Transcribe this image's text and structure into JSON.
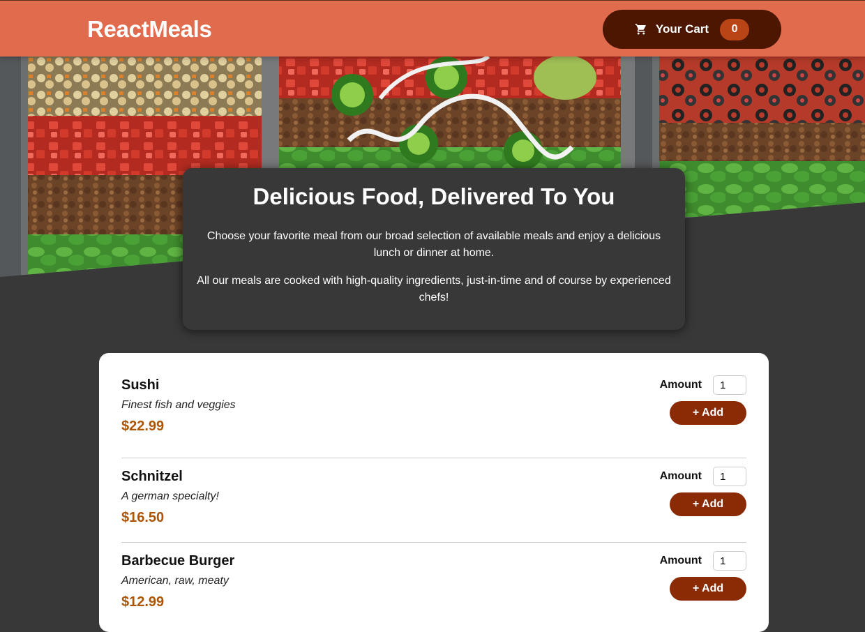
{
  "header": {
    "brand": "ReactMeals",
    "cart_label": "Your Cart",
    "cart_count": "0"
  },
  "summary": {
    "title": "Delicious Food, Delivered To You",
    "paragraph1": "Choose your favorite meal from our broad selection of available meals and enjoy a delicious lunch or dinner at home.",
    "paragraph2": "All our meals are cooked with high-quality ingredients, just-in-time and of course by experienced chefs!"
  },
  "meals": [
    {
      "name": "Sushi",
      "description": "Finest fish and veggies",
      "price": "$22.99",
      "amount_label": "Amount",
      "amount_value": "1",
      "add_label": "+ Add"
    },
    {
      "name": "Schnitzel",
      "description": "A german specialty!",
      "price": "$16.50",
      "amount_label": "Amount",
      "amount_value": "1",
      "add_label": "+ Add"
    },
    {
      "name": "Barbecue Burger",
      "description": "American, raw, meaty",
      "price": "$12.99",
      "amount_label": "Amount",
      "amount_value": "1",
      "add_label": "+ Add"
    }
  ],
  "colors": {
    "header_bg": "#e06c4d",
    "cart_bg": "#4d1601",
    "badge_bg": "#b94517",
    "add_button_bg": "#8a2b06",
    "price_color": "#ad5502",
    "page_bg": "#383838"
  },
  "icons": {
    "cart": "cart-icon"
  }
}
